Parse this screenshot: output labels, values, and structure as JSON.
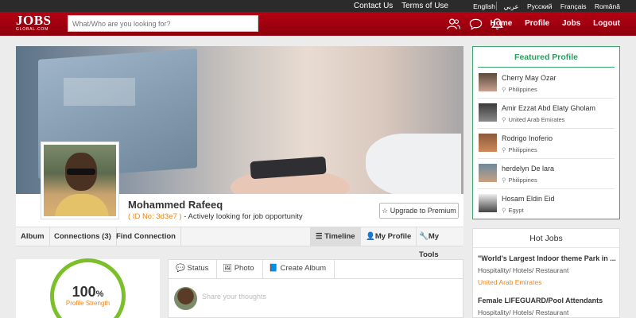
{
  "topbar": {
    "links": [
      "Contact Us",
      "Terms of Use"
    ],
    "languages": [
      "English",
      "عربي",
      "Русский",
      "Français",
      "Română"
    ]
  },
  "header": {
    "logo_main": "JOBS",
    "logo_sub": "GLOBAL.COM",
    "search_placeholder": "What/Who are you looking for?",
    "icons": [
      "people-icon",
      "chat-icon",
      "bell-icon"
    ],
    "nav": [
      "Home",
      "Profile",
      "Jobs",
      "Logout"
    ]
  },
  "profile": {
    "name": "Mohammed Rafeeq",
    "id_text": "( ID No: 3d3e7 )",
    "status": "- Actively looking for job opportunity",
    "upgrade_label": "Upgrade to Premium",
    "tabs_left": [
      "Album",
      "Connections (3)",
      "Find Connection"
    ],
    "tabs_right": [
      "Timeline",
      "My Profile",
      "My Tools"
    ],
    "strength_value": "100",
    "strength_unit": "%",
    "strength_label": "Profile Strength"
  },
  "composer": {
    "tabs": [
      "Status",
      "Photo",
      "Create Album"
    ],
    "placeholder": "Share your thoughts"
  },
  "featured": {
    "title": "Featured Profile",
    "people": [
      {
        "name": "Cherry May Ozar",
        "location": "Philippines"
      },
      {
        "name": "Amir Ezzat Abd Elaty Gholam",
        "location": "United Arab Emirates"
      },
      {
        "name": "Rodrigo Inoferio",
        "location": "Philippines"
      },
      {
        "name": "herdelyn De lara",
        "location": "Philippines"
      },
      {
        "name": "Hosam Eldin Eid",
        "location": "Egypt"
      }
    ]
  },
  "hotjobs": {
    "title": "Hot Jobs",
    "jobs": [
      {
        "title": "\"World's Largest Indoor theme Park in ...",
        "category": "Hospitality/ Hotels/ Restaurant",
        "location": "United Arab Emirates"
      },
      {
        "title": "Female LIFEGUARD/Pool Attendants",
        "category": "Hospitality/ Hotels/ Restaurant",
        "location": ""
      }
    ]
  },
  "colors": {
    "brand_red": "#a5000f",
    "accent_orange": "#e8871e",
    "featured_green": "#3aa86c",
    "ring_green": "#7bbf2a"
  }
}
